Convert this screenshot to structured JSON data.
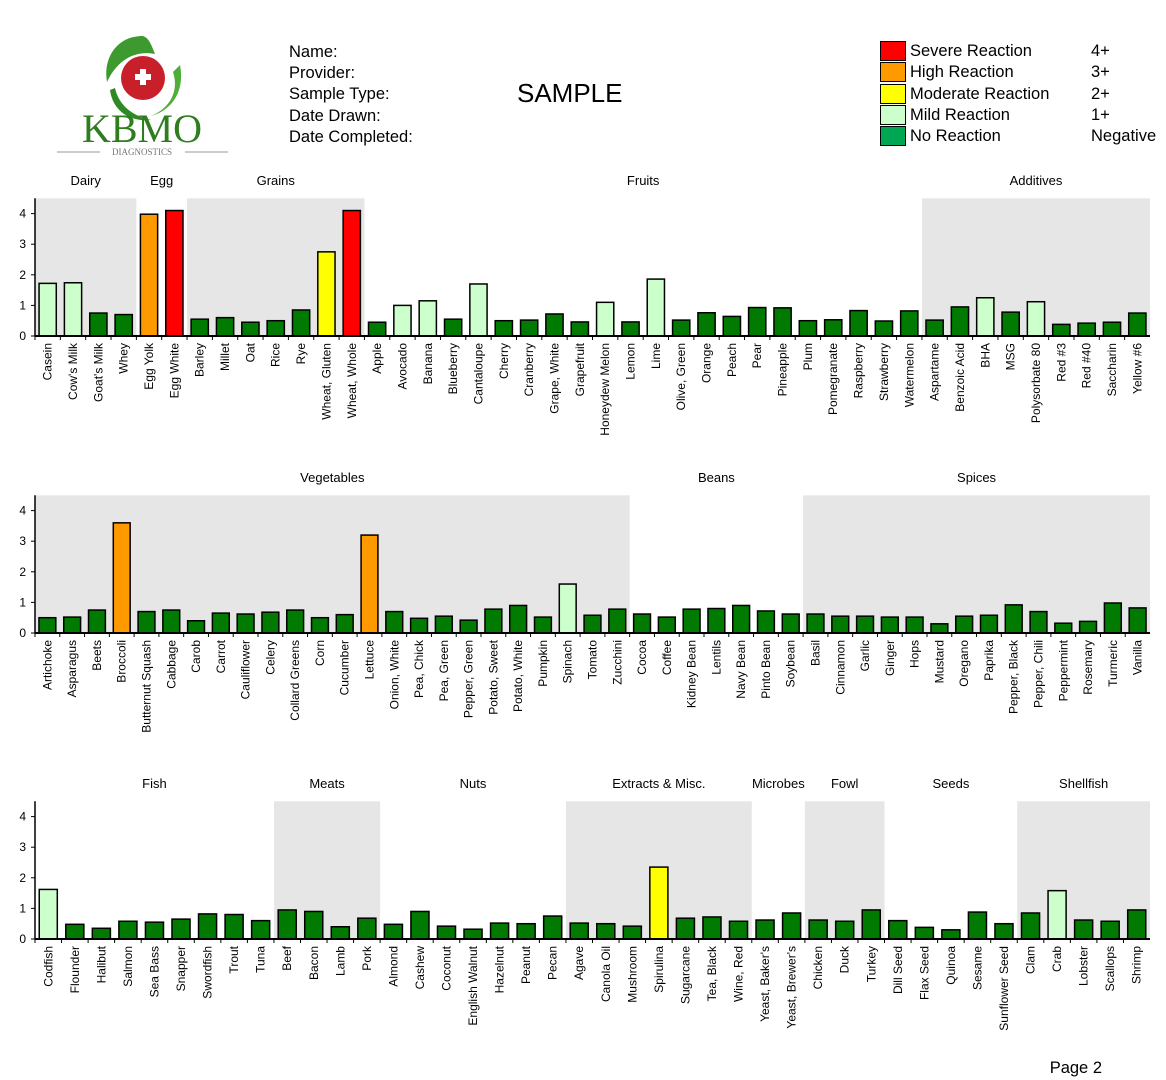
{
  "header": {
    "logo_text": "KBMO",
    "logo_subtext": "DIAGNOSTICS",
    "fields": [
      "Name:",
      "Provider:",
      "Sample Type:",
      "Date Drawn:",
      "Date Completed:"
    ],
    "watermark": "SAMPLE"
  },
  "legend": [
    {
      "label": "Severe Reaction",
      "level": "4+",
      "color": "#ff0000"
    },
    {
      "label": "High Reaction",
      "level": "3+",
      "color": "#ff9900"
    },
    {
      "label": "Moderate Reaction",
      "level": "2+",
      "color": "#ffff00"
    },
    {
      "label": "Mild Reaction",
      "level": "1+",
      "color": "#ccffcc"
    },
    {
      "label": "No Reaction",
      "level": "Negative",
      "color": "#00a651"
    }
  ],
  "bar_colors": {
    "severe": "#ff0000",
    "high": "#ff9900",
    "moderate": "#ffff00",
    "mild": "#ccffcc",
    "none": "#007a00"
  },
  "shade_color": "#e6e6e6",
  "chart_data": [
    {
      "type": "bar",
      "ylim": [
        0,
        4.5
      ],
      "yticks": [
        0,
        1,
        2,
        3,
        4
      ],
      "groups": [
        {
          "name": "Dairy",
          "shaded": true,
          "categories": [
            "Casein",
            "Cow's Milk",
            "Goat's Milk",
            "Whey"
          ],
          "values": [
            1.72,
            1.74,
            0.75,
            0.7
          ]
        },
        {
          "name": "Egg",
          "shaded": false,
          "categories": [
            "Egg Yolk",
            "Egg White"
          ],
          "values": [
            3.98,
            4.1
          ]
        },
        {
          "name": "Grains",
          "shaded": true,
          "categories": [
            "Barley",
            "Millet",
            "Oat",
            "Rice",
            "Rye",
            "Wheat, Gluten",
            "Wheat, Whole"
          ],
          "values": [
            0.55,
            0.6,
            0.45,
            0.5,
            0.85,
            2.75,
            4.1
          ]
        },
        {
          "name": "Fruits",
          "shaded": false,
          "categories": [
            "Apple",
            "Avocado",
            "Banana",
            "Blueberry",
            "Cantaloupe",
            "Cherry",
            "Cranberry",
            "Grape, White",
            "Grapefruit",
            "Honeydew Melon",
            "Lemon",
            "Lime",
            "Olive, Green",
            "Orange",
            "Peach",
            "Pear",
            "Pineapple",
            "Plum",
            "Pomegranate",
            "Raspberry",
            "Strawberry",
            "Watermelon"
          ],
          "values": [
            0.45,
            1.0,
            1.15,
            0.55,
            1.7,
            0.5,
            0.52,
            0.72,
            0.46,
            1.1,
            0.46,
            1.86,
            0.52,
            0.76,
            0.64,
            0.93,
            0.92,
            0.5,
            0.53,
            0.83,
            0.49,
            0.82
          ]
        },
        {
          "name": "Additives",
          "shaded": true,
          "categories": [
            "Aspartame",
            "Benzoic Acid",
            "BHA",
            "MSG",
            "Polysorbate 80",
            "Red #3",
            "Red #40",
            "Saccharin",
            "Yellow #6"
          ],
          "values": [
            0.52,
            0.95,
            1.25,
            0.78,
            1.12,
            0.38,
            0.42,
            0.45,
            0.75
          ]
        }
      ]
    },
    {
      "type": "bar",
      "ylim": [
        0,
        4.5
      ],
      "yticks": [
        0,
        1,
        2,
        3,
        4
      ],
      "groups": [
        {
          "name": "Vegetables",
          "shaded": true,
          "categories": [
            "Artichoke",
            "Asparagus",
            "Beets",
            "Broccoli",
            "Butternut Squash",
            "Cabbage",
            "Carob",
            "Carrot",
            "Cauliflower",
            "Celery",
            "Collard Greens",
            "Corn",
            "Cucumber",
            "Lettuce",
            "Onion, White",
            "Pea, Chick",
            "Pea, Green",
            "Pepper, Green",
            "Potato, Sweet",
            "Potato, White",
            "Pumpkin",
            "Spinach",
            "Tomato",
            "Zucchini"
          ],
          "values": [
            0.5,
            0.52,
            0.75,
            3.6,
            0.7,
            0.75,
            0.4,
            0.65,
            0.62,
            0.68,
            0.75,
            0.5,
            0.6,
            3.2,
            0.7,
            0.48,
            0.55,
            0.42,
            0.78,
            0.9,
            0.52,
            1.6,
            0.58,
            0.78
          ]
        },
        {
          "name": "Beans",
          "shaded": false,
          "categories": [
            "Cocoa",
            "Coffee",
            "Kidney Bean",
            "Lentils",
            "Navy Bean",
            "Pinto Bean",
            "Soybean"
          ],
          "values": [
            0.62,
            0.52,
            0.78,
            0.8,
            0.9,
            0.72,
            0.62
          ]
        },
        {
          "name": "Spices",
          "shaded": true,
          "categories": [
            "Basil",
            "Cinnamon",
            "Garlic",
            "Ginger",
            "Hops",
            "Mustard",
            "Oregano",
            "Paprika",
            "Pepper, Black",
            "Pepper, Chili",
            "Peppermint",
            "Rosemary",
            "Turmeric",
            "Vanilla"
          ],
          "values": [
            0.62,
            0.55,
            0.55,
            0.52,
            0.52,
            0.3,
            0.55,
            0.58,
            0.92,
            0.7,
            0.32,
            0.38,
            0.98,
            0.82
          ]
        }
      ]
    },
    {
      "type": "bar",
      "ylim": [
        0,
        4.5
      ],
      "yticks": [
        0,
        1,
        2,
        3,
        4
      ],
      "groups": [
        {
          "name": "Fish",
          "shaded": false,
          "categories": [
            "Codfish",
            "Flounder",
            "Halibut",
            "Salmon",
            "Sea Bass",
            "Snapper",
            "Swordfish",
            "Trout",
            "Tuna"
          ],
          "values": [
            1.62,
            0.48,
            0.35,
            0.58,
            0.55,
            0.65,
            0.82,
            0.8,
            0.6
          ]
        },
        {
          "name": "Meats",
          "shaded": true,
          "categories": [
            "Beef",
            "Bacon",
            "Lamb",
            "Pork"
          ],
          "values": [
            0.95,
            0.9,
            0.4,
            0.68
          ]
        },
        {
          "name": "Nuts",
          "shaded": false,
          "categories": [
            "Almond",
            "Cashew",
            "Coconut",
            "English Walnut",
            "Hazelnut",
            "Peanut",
            "Pecan"
          ],
          "values": [
            0.48,
            0.9,
            0.42,
            0.32,
            0.52,
            0.5,
            0.75
          ]
        },
        {
          "name": "Extracts & Misc.",
          "shaded": true,
          "categories": [
            "Agave",
            "Canola Oil",
            "Mushroom",
            "Spirulina",
            "Sugarcane",
            "Tea, Black",
            "Wine, Red"
          ],
          "values": [
            0.52,
            0.5,
            0.42,
            2.35,
            0.68,
            0.72,
            0.58
          ]
        },
        {
          "name": "Microbes",
          "shaded": false,
          "categories": [
            "Yeast, Baker's",
            "Yeast, Brewer's"
          ],
          "values": [
            0.62,
            0.85
          ]
        },
        {
          "name": "Fowl",
          "shaded": true,
          "categories": [
            "Chicken",
            "Duck",
            "Turkey"
          ],
          "values": [
            0.62,
            0.58,
            0.95
          ]
        },
        {
          "name": "Seeds",
          "shaded": false,
          "categories": [
            "Dill Seed",
            "Flax Seed",
            "Quinoa",
            "Sesame",
            "Sunflower Seed"
          ],
          "values": [
            0.6,
            0.38,
            0.3,
            0.88,
            0.5
          ]
        },
        {
          "name": "Shellfish",
          "shaded": true,
          "categories": [
            "Clam",
            "Crab",
            "Lobster",
            "Scallops",
            "Shrimp"
          ],
          "values": [
            0.85,
            1.58,
            0.62,
            0.58,
            0.95
          ]
        }
      ]
    }
  ],
  "footer": {
    "page": "Page 2"
  }
}
